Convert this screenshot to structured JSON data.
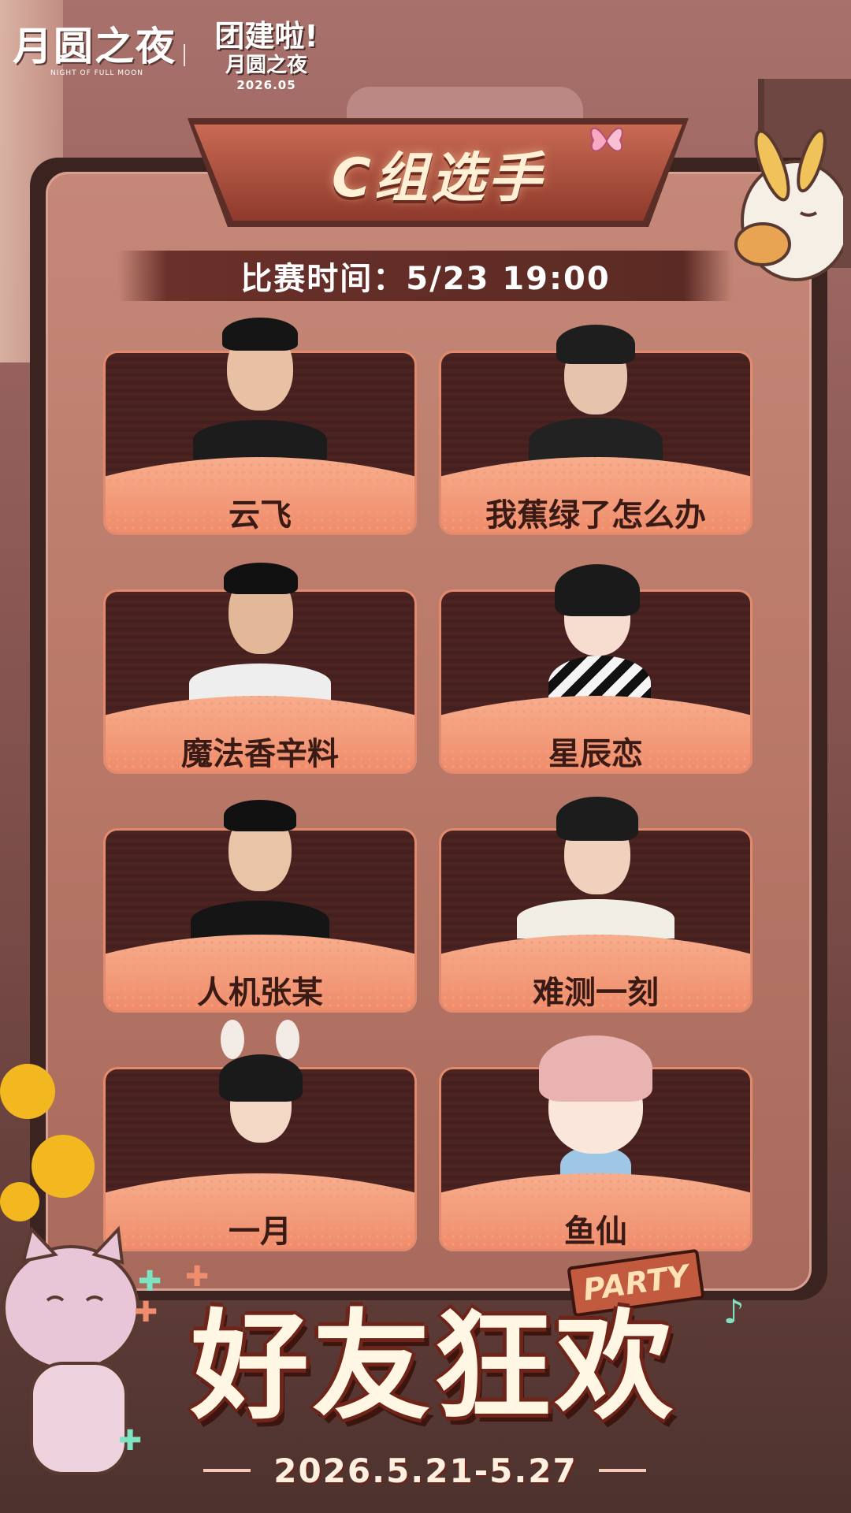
{
  "brand": {
    "logo_title": "月圆之夜",
    "logo_subtitle": "NIGHT OF FULL MOON",
    "event_line1": "团建啦!",
    "event_line2": "月圆之夜",
    "event_date": "2026.05"
  },
  "header": {
    "group_title": "C组选手",
    "match_time": "比赛时间：5/23 19:00"
  },
  "players": [
    {
      "name": "云飞"
    },
    {
      "name": "我蕉绿了怎么办"
    },
    {
      "name": "魔法香辛料"
    },
    {
      "name": "星辰恋"
    },
    {
      "name": "人机张某"
    },
    {
      "name": "难测一刻"
    },
    {
      "name": "一月"
    },
    {
      "name": "鱼仙"
    }
  ],
  "footer": {
    "party_tag": "PARTY",
    "headline": "好友狂欢",
    "date_range": "2026.5.21-5.27"
  },
  "colors": {
    "accent": "#ef8c6b",
    "banner": "#8e3a2c",
    "frame": "#3b2420"
  }
}
